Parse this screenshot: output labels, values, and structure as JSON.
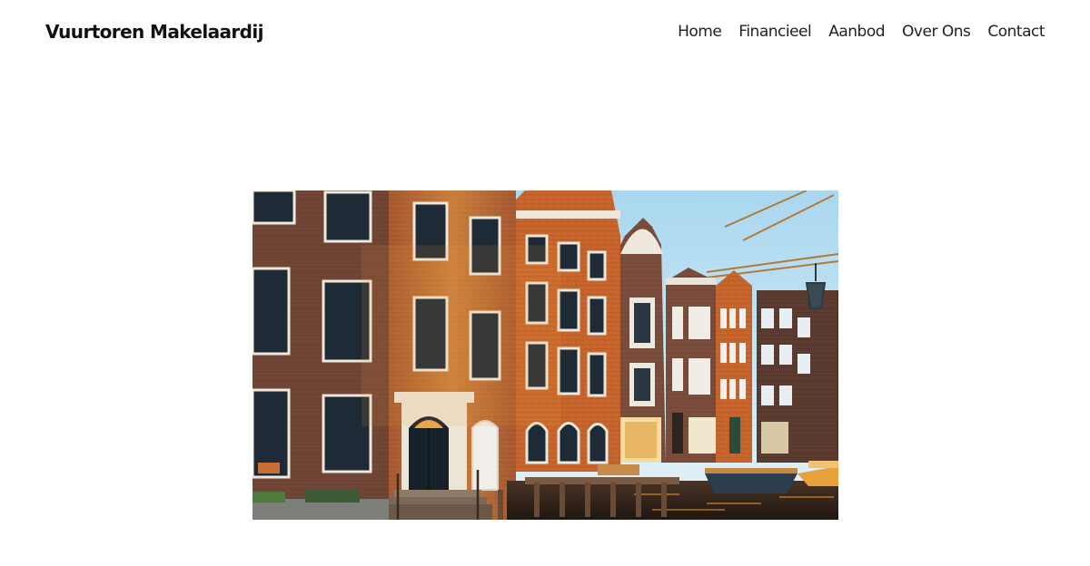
{
  "site": {
    "title": "Vuurtoren Makelaardij"
  },
  "nav": {
    "items": [
      {
        "label": "Home"
      },
      {
        "label": "Financieel"
      },
      {
        "label": "Aanbod"
      },
      {
        "label": "Over Ons"
      },
      {
        "label": "Contact"
      }
    ]
  },
  "hero": {
    "palette": {
      "sky": "#bfe1f2",
      "brick_dark": "#7a4a3a",
      "brick_warm": "#b65a2a",
      "brick_orange": "#d06a2c",
      "brick_deep": "#5a3a30",
      "window": "#1e2a36",
      "water": "#3a2a20",
      "highlight": "#f3a640"
    }
  }
}
